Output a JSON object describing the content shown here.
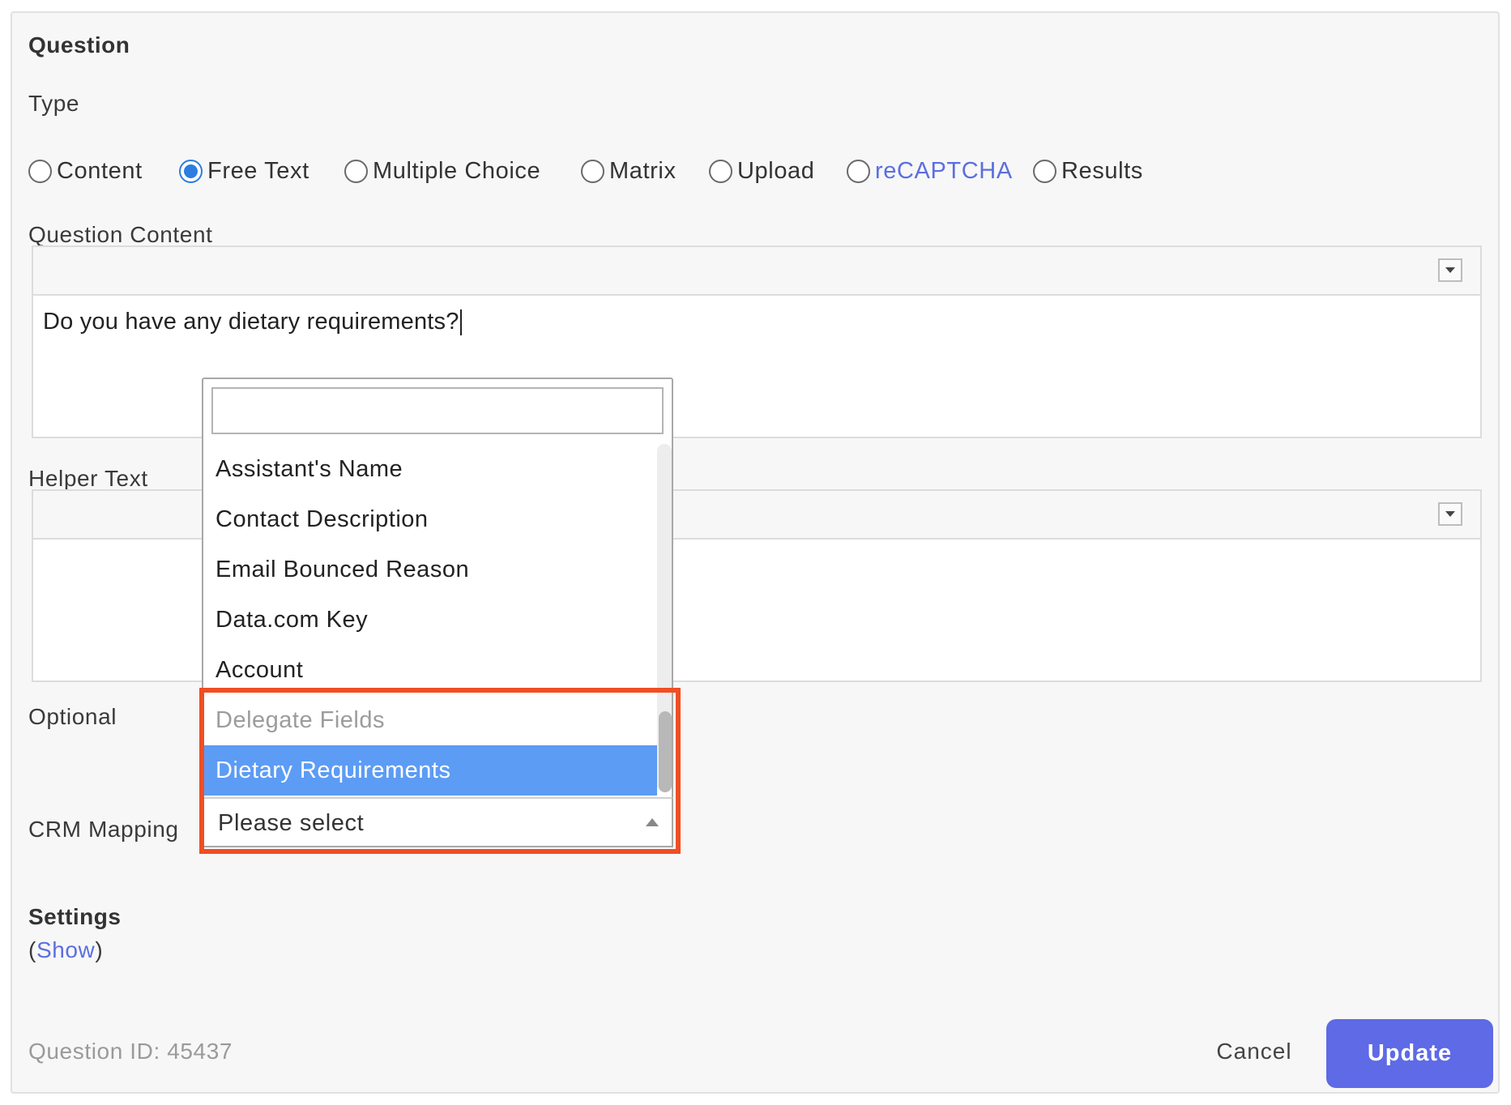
{
  "question_section": {
    "title": "Question"
  },
  "type": {
    "label": "Type",
    "options": [
      {
        "label": "Content",
        "checked": false
      },
      {
        "label": "Free Text",
        "checked": true
      },
      {
        "label": "Multiple Choice",
        "checked": false
      },
      {
        "label": "Matrix",
        "checked": false
      },
      {
        "label": "Upload",
        "checked": false
      },
      {
        "label": "reCAPTCHA",
        "checked": false
      },
      {
        "label": "Results",
        "checked": false
      }
    ]
  },
  "question_content": {
    "label": "Question Content",
    "value": "Do you have any dietary requirements?"
  },
  "helper_text": {
    "label": "Helper Text",
    "value": ""
  },
  "optional": {
    "label": "Optional"
  },
  "crm_mapping": {
    "label": "CRM Mapping",
    "search_value": "",
    "items": [
      {
        "label": "Assistant's Name",
        "kind": "option"
      },
      {
        "label": "Contact Description",
        "kind": "option"
      },
      {
        "label": "Email Bounced Reason",
        "kind": "option"
      },
      {
        "label": "Data.com Key",
        "kind": "option"
      },
      {
        "label": "Account",
        "kind": "option"
      },
      {
        "label": "Delegate Fields",
        "kind": "group"
      },
      {
        "label": "Dietary Requirements",
        "kind": "selected"
      }
    ],
    "select_value": "Please select",
    "highlight_color": "#f04e23",
    "selected_color": "#5c9cf5"
  },
  "settings": {
    "title": "Settings",
    "open_paren": "(",
    "toggle_label": "Show",
    "close_paren": ")"
  },
  "footer": {
    "question_id": "Question ID: 45437",
    "cancel_label": "Cancel",
    "update_label": "Update",
    "accent_color": "#5e6ae6"
  }
}
